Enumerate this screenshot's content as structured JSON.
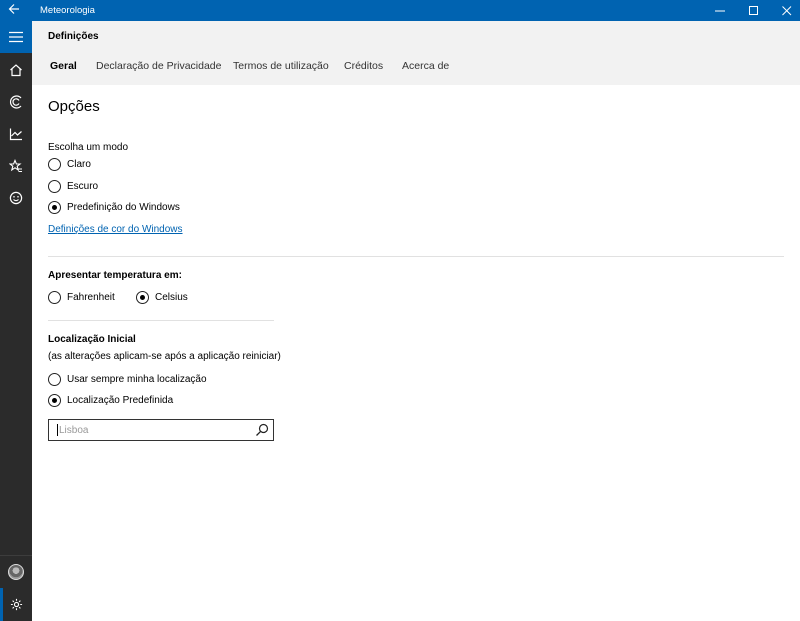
{
  "window": {
    "title": "Meteorologia",
    "controls": [
      "minimize-icon",
      "maximize-icon",
      "close-icon"
    ],
    "accent": "#0063b1"
  },
  "sidebar": {
    "items": [
      "menu-icon",
      "home-icon",
      "forecast-icon",
      "chart-icon",
      "favorites-icon",
      "feedback-icon"
    ],
    "bottom": [
      "avatar",
      "settings-icon"
    ]
  },
  "header": {
    "title": "Definições",
    "tabs": [
      {
        "label": "Geral",
        "active": true
      },
      {
        "label": "Declaração de Privacidade",
        "active": false
      },
      {
        "label": "Termos de utilização",
        "active": false
      },
      {
        "label": "Créditos",
        "active": false
      },
      {
        "label": "Acerca de",
        "active": false
      }
    ]
  },
  "options": {
    "title": "Opções",
    "mode": {
      "label": "Escolha um modo",
      "choices": [
        {
          "label": "Claro",
          "checked": false
        },
        {
          "label": "Escuro",
          "checked": false
        },
        {
          "label": "Predefinição do Windows",
          "checked": true
        }
      ],
      "link": "Definições de cor do Windows"
    },
    "temperature": {
      "label": "Apresentar temperatura em:",
      "choices": [
        {
          "label": "Fahrenheit",
          "checked": false
        },
        {
          "label": "Celsius",
          "checked": true
        }
      ]
    },
    "location": {
      "label": "Localização Inicial",
      "note": "(as alterações aplicam-se após a aplicação reiniciar)",
      "choices": [
        {
          "label": "Usar sempre minha localização",
          "checked": false
        },
        {
          "label": "Localização Predefinida",
          "checked": true
        }
      ],
      "search_value": "Lisboa"
    }
  }
}
